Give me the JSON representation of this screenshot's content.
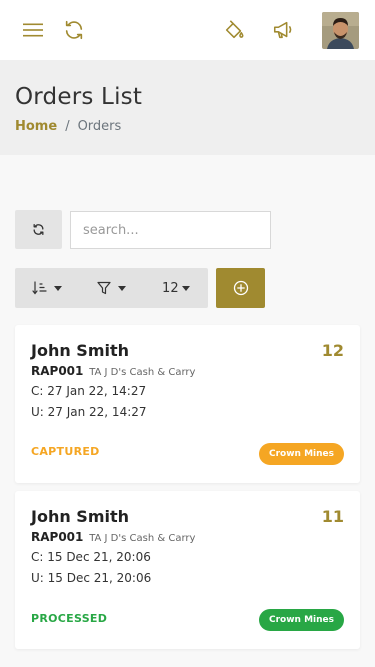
{
  "header": {
    "menu_icon": "menu-icon",
    "sync_icon": "sync-icon",
    "paint_icon": "paint-bucket-icon",
    "announce_icon": "megaphone-icon",
    "avatar_icon": "avatar-photo"
  },
  "page": {
    "title": "Orders List",
    "breadcrumb_home": "Home",
    "breadcrumb_separator": "/",
    "breadcrumb_current": "Orders"
  },
  "toolbar": {
    "search_placeholder": "search...",
    "page_size": "12"
  },
  "colors": {
    "accent": "#a08a30",
    "captured": "#f5a623",
    "processed": "#28a745"
  },
  "orders": [
    {
      "name": "John Smith",
      "number": "12",
      "code": "RAP001",
      "shop": "TA J D's Cash & Carry",
      "created": "C: 27 Jan 22, 14:27",
      "updated": "U: 27 Jan 22, 14:27",
      "status": "CAPTURED",
      "location": "Crown Mines"
    },
    {
      "name": "John Smith",
      "number": "11",
      "code": "RAP001",
      "shop": "TA J D's Cash & Carry",
      "created": "C: 15 Dec 21, 20:06",
      "updated": "U: 15 Dec 21, 20:06",
      "status": "PROCESSED",
      "location": "Crown Mines"
    }
  ]
}
